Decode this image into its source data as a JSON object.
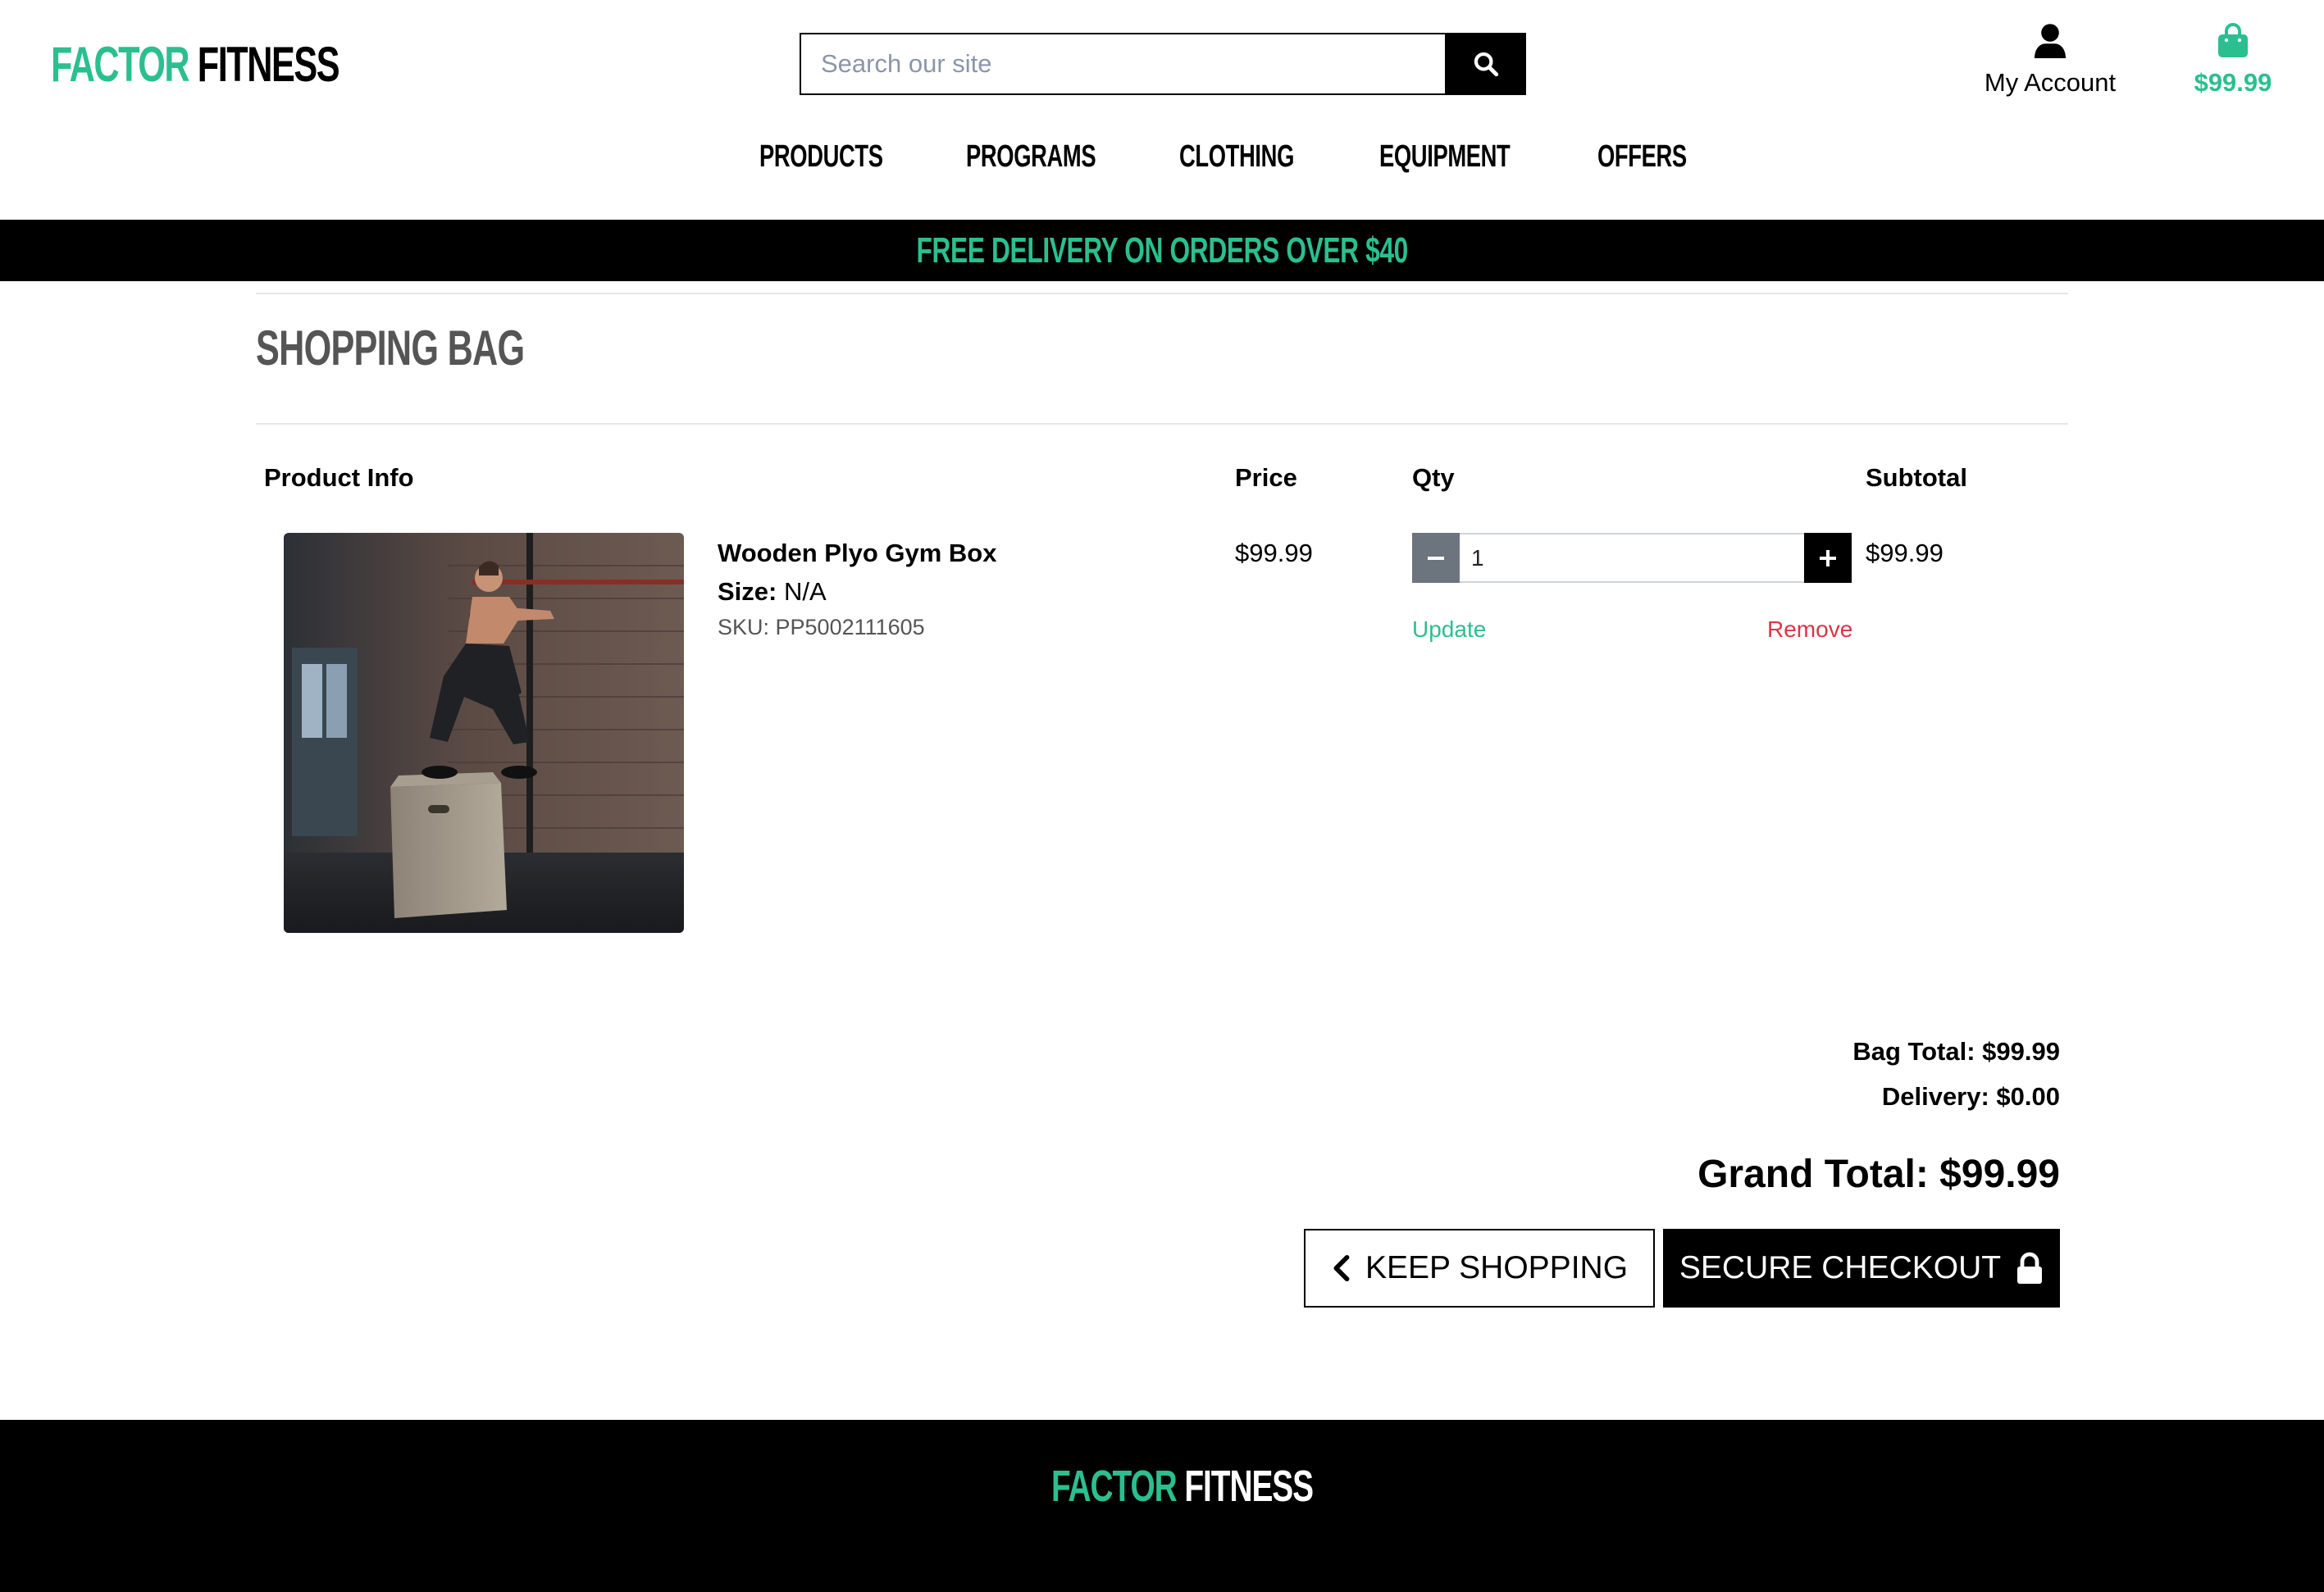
{
  "brand": {
    "part1": "FACTOR",
    "part2": "FITNESS"
  },
  "search": {
    "placeholder": "Search our site"
  },
  "header": {
    "account_label": "My Account",
    "bag_total": "$99.99"
  },
  "nav": {
    "items": [
      "PRODUCTS",
      "PROGRAMS",
      "CLOTHING",
      "EQUIPMENT",
      "OFFERS"
    ]
  },
  "banner": {
    "text": "FREE DELIVERY ON ORDERS OVER $40"
  },
  "page": {
    "title": "SHOPPING BAG"
  },
  "table": {
    "headers": {
      "product": "Product Info",
      "price": "Price",
      "qty": "Qty",
      "subtotal": "Subtotal"
    },
    "items": [
      {
        "name": "Wooden Plyo Gym Box",
        "size_label": "Size:",
        "size": "N/A",
        "sku": "SKU: PP5002111605",
        "price": "$99.99",
        "qty": "1",
        "subtotal": "$99.99",
        "update_label": "Update",
        "remove_label": "Remove"
      }
    ]
  },
  "totals": {
    "bag_total": "Bag Total: $99.99",
    "delivery": "Delivery: $0.00",
    "grand_total": "Grand Total: $99.99"
  },
  "actions": {
    "keep_shopping": "KEEP SHOPPING",
    "secure_checkout": "SECURE CHECKOUT"
  },
  "icons": {
    "search": "search-icon",
    "account": "user-icon",
    "bag": "shopping-bag-icon",
    "minus": "minus-icon",
    "plus": "plus-icon",
    "back": "chevron-left-icon",
    "lock": "lock-icon"
  },
  "colors": {
    "accent": "#2bbf8f",
    "danger": "#dc3545",
    "dark": "#000000",
    "muted_button": "#6c757d"
  }
}
